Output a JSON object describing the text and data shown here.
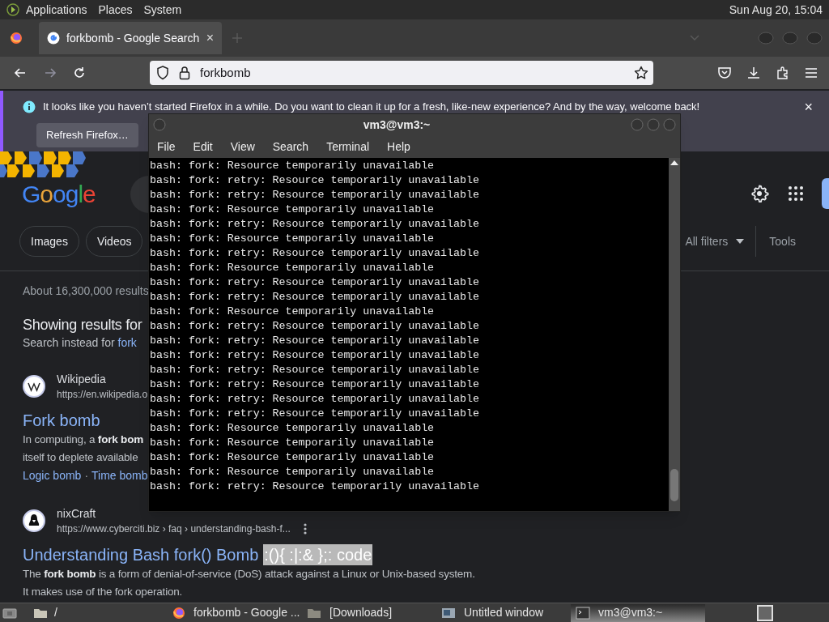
{
  "top_panel": {
    "menus": [
      "Applications",
      "Places",
      "System"
    ],
    "clock": "Sun Aug 20, 15:04"
  },
  "browser": {
    "tabs": [
      {
        "title": "forkbomb - Google Search",
        "close": "×",
        "selected": true
      }
    ],
    "address": "forkbomb",
    "notification": {
      "text": "It looks like you haven’t started Firefox in a while. Do you want to clean it up for a fresh, like-new experience? And by the way, welcome back!",
      "close": "×",
      "button": "Refresh Firefox…"
    },
    "page": {
      "logo": "Google",
      "chips": [
        "Images",
        "Videos"
      ],
      "filters": [
        {
          "label": "All filters",
          "dropdown": true
        },
        {
          "label": "Tools",
          "dropdown": false
        }
      ],
      "result_stats": "About 16,300,000 results",
      "showing": "Showing results for",
      "search_instead": "Search instead for",
      "search_instead_link": "fork",
      "results": [
        {
          "site": "Wikipedia",
          "url": "https://en.wikipedia.o",
          "title": "Fork bomb",
          "snippet": [
            "In computing, a **fork bom**",
            "itself to deplete available"
          ],
          "links": [
            "Logic bomb",
            "Time bomb"
          ],
          "link_separator": "·",
          "more": false
        },
        {
          "site": "nixCraft",
          "url": "https://www.cyberciti.biz › faq › understanding-bash-f...",
          "title": "Understanding Bash fork() Bomb",
          "title_highlight": ":(){ :|:& };: code",
          "snippet": [
            "The **fork bomb** is a form of denial-of-service (DoS) attack against a Linux or Unix-based system.",
            "It makes use of the fork operation."
          ],
          "more": true
        }
      ]
    }
  },
  "terminal": {
    "title": "vm3@vm3:~",
    "menus": [
      "File",
      "Edit",
      "View",
      "Search",
      "Terminal",
      "Help"
    ],
    "lines": [
      "bash: fork: Resource temporarily unavailable",
      "bash: fork: retry: Resource temporarily unavailable",
      "bash: fork: retry: Resource temporarily unavailable",
      "bash: fork: Resource temporarily unavailable",
      "bash: fork: retry: Resource temporarily unavailable",
      "bash: fork: Resource temporarily unavailable",
      "bash: fork: retry: Resource temporarily unavailable",
      "bash: fork: Resource temporarily unavailable",
      "bash: fork: retry: Resource temporarily unavailable",
      "bash: fork: retry: Resource temporarily unavailable",
      "bash: fork: Resource temporarily unavailable",
      "bash: fork: retry: Resource temporarily unavailable",
      "bash: fork: retry: Resource temporarily unavailable",
      "bash: fork: retry: Resource temporarily unavailable",
      "bash: fork: retry: Resource temporarily unavailable",
      "bash: fork: retry: Resource temporarily unavailable",
      "bash: fork: retry: Resource temporarily unavailable",
      "bash: fork: retry: Resource temporarily unavailable",
      "bash: fork: Resource temporarily unavailable",
      "bash: fork: Resource temporarily unavailable",
      "bash: fork: Resource temporarily unavailable",
      "bash: fork: Resource temporarily unavailable",
      "bash: fork: retry: Resource temporarily unavailable"
    ]
  },
  "taskbar": {
    "location": "/",
    "windows": [
      {
        "kind": "firefox",
        "title": "forkbomb - Google ...",
        "selected": false
      },
      {
        "kind": "folder",
        "title": "[Downloads]",
        "selected": false
      },
      {
        "kind": "app",
        "title": "Untitled window",
        "selected": false
      },
      {
        "kind": "terminal",
        "title": "vm3@vm3:~",
        "selected": true
      }
    ]
  }
}
